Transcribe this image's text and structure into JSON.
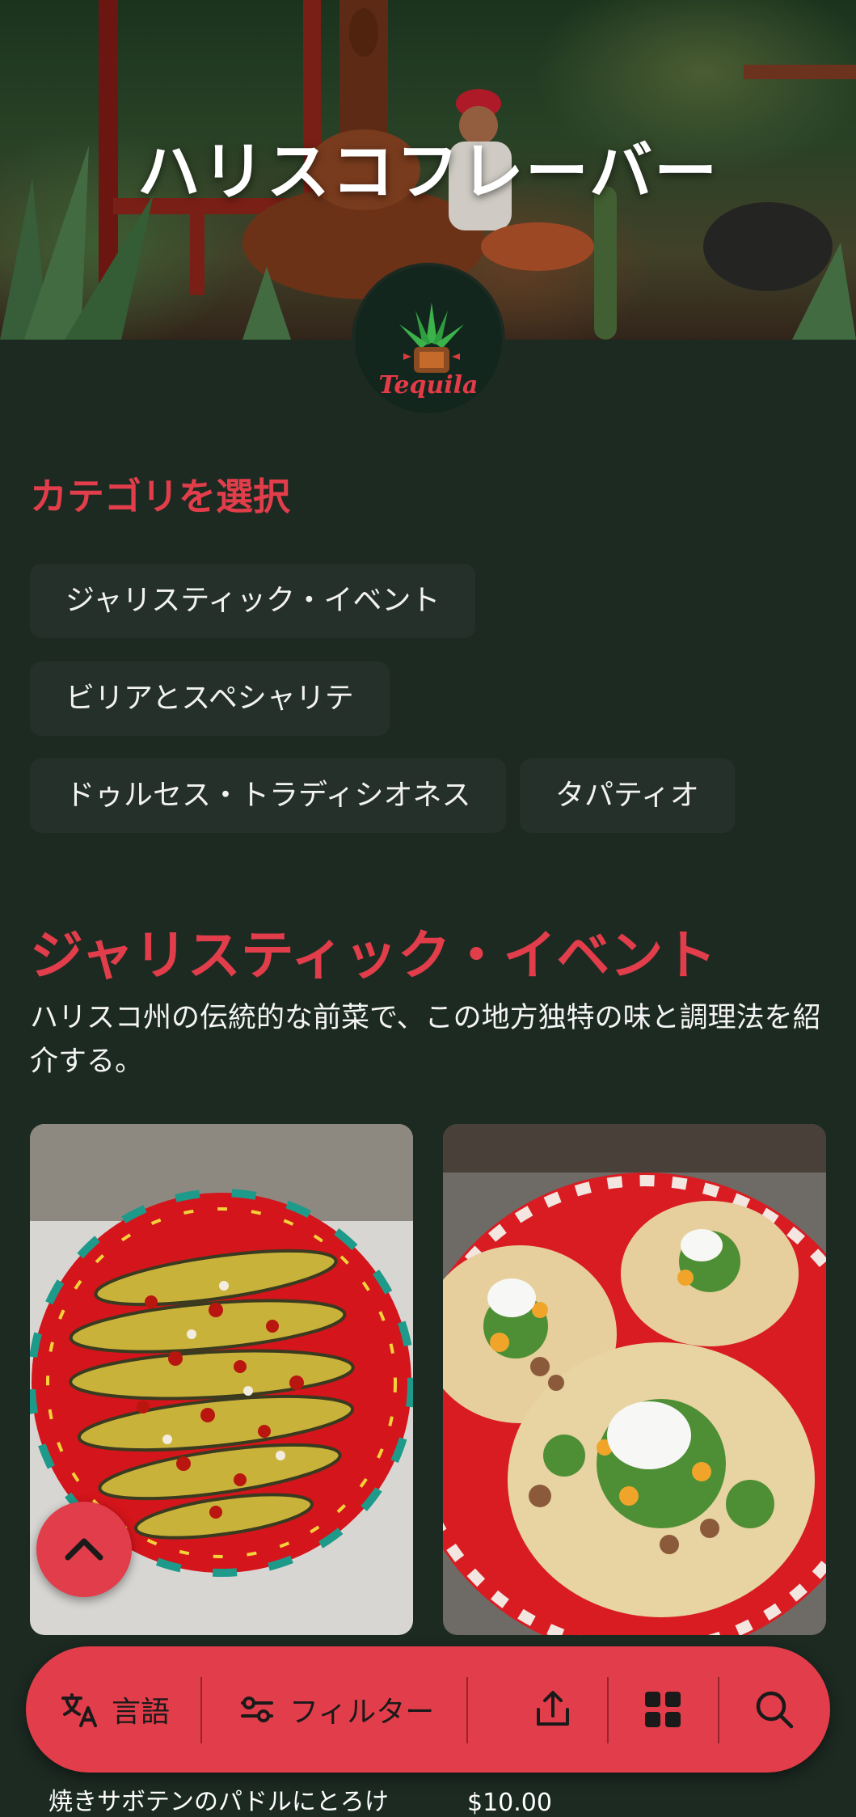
{
  "hero": {
    "title": "ハリスコフレーバー",
    "logo_text": "Tequila"
  },
  "categories": {
    "heading": "カテゴリを選択",
    "items": [
      {
        "label": "ジャリスティック・イベント"
      },
      {
        "label": "ビリアとスペシャリテ"
      },
      {
        "label": "ドゥルセス・トラディシオネス"
      },
      {
        "label": "タパティオ"
      }
    ]
  },
  "section": {
    "title": "ジャリスティック・イベント",
    "description": "ハリスコ州の伝統的な前菜で、この地方独特の味と調理法を紹介する。",
    "cards": [
      {
        "caption": "焼きサボテンのパドルにとろけ",
        "image": "grilled-nopal-plate-image"
      },
      {
        "caption": "",
        "price": "$10.00",
        "image": "chicken-tostadas-image"
      }
    ]
  },
  "toolbar": {
    "language_label": "言語",
    "filter_label": "フィルター",
    "icons": [
      "translate-icon",
      "sliders-icon",
      "share-icon",
      "grid-icon",
      "search-icon"
    ]
  },
  "colors": {
    "background": "#1c2a22",
    "accent": "#e23d4a",
    "chip": "#25302a"
  }
}
